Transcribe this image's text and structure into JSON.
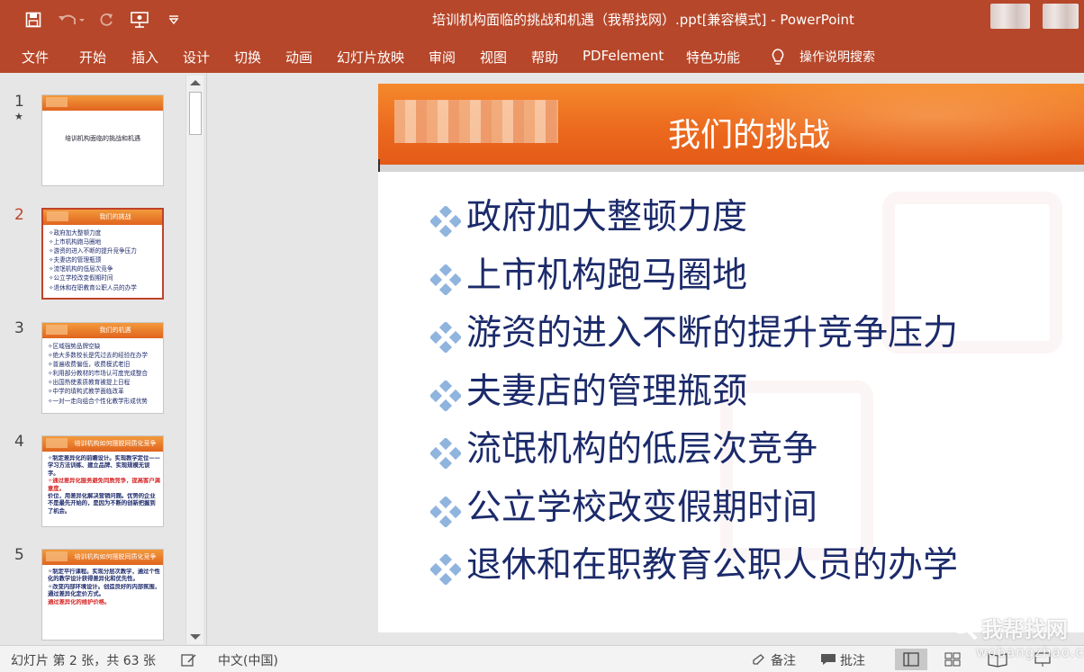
{
  "window": {
    "title": "培训机构面临的挑战和机遇（我帮找网）.ppt[兼容模式]  -  PowerPoint"
  },
  "quick_access": [
    "save-icon",
    "undo-icon",
    "redo-icon",
    "present-from-start-icon",
    "customize-icon"
  ],
  "ribbon": {
    "tabs": [
      "文件",
      "开始",
      "插入",
      "设计",
      "切换",
      "动画",
      "幻灯片放映",
      "审阅",
      "视图",
      "帮助",
      "PDFelement",
      "特色功能"
    ],
    "search_label": "操作说明搜索"
  },
  "thumbnails": [
    {
      "number": "1",
      "has_animation": true,
      "title": "培训机构面临的挑战和机遇",
      "items": []
    },
    {
      "number": "2",
      "active": true,
      "title": "我们的挑战",
      "items": [
        "政府加大整顿力度",
        "上市机构跑马圈地",
        "游资的进入不断的提升竞争压力",
        "夫妻店的管理瓶颈",
        "流氓机构的低层次竞争",
        "公立学校改变假期时间",
        "退休和在职教育公职人员的办学"
      ]
    },
    {
      "number": "3",
      "title": "我们的机遇",
      "items": [
        "区域强势品牌空缺",
        "绝大多数校长是凭过去的经验在办学",
        "普遍收费偏低，收费模式老旧",
        "利用部分教材的市场认可度完成整合",
        "出国热使素质教育被提上日程",
        "中学的填鸭式教学面临改革",
        "一对一走向组合个性化教学形成优势"
      ]
    },
    {
      "number": "4",
      "title": "培训机构如何摆脱同质化竞争",
      "items": [
        {
          "text": "制定差异化的前瞻设计。实现教学定位——学习方法训练、建立品牌、实现规模无误字。",
          "red": false
        },
        {
          "text": "通过差异化服务避免同质竞争，提高客户满意度。",
          "red": true
        },
        {
          "text": "价位，用差异化解决营销问题。优势的企业不是最先开始的，是因为不断的创新把握到了机会。",
          "red": false
        }
      ]
    },
    {
      "number": "5",
      "title": "培训机构如何摆脱同质化竞争",
      "items": [
        {
          "text": "制定平行课程。实现分层次教学，通过个性化的教学设计获得差异化和优先性。",
          "red": false
        },
        {
          "text": "改变内部环境设计。创造良好的内部氛围，通过差异化定价方式。",
          "red": false
        },
        {
          "text": "通过差异化的维护价格。",
          "red": true
        }
      ]
    }
  ],
  "slide": {
    "title": "我们的挑战",
    "bullets": [
      "政府加大整顿力度",
      "上市机构跑马圈地",
      "游资的进入不断的提升竞争压力",
      "夫妻店的管理瓶颈",
      "流氓机构的低层次竞争",
      "公立学校改变假期时间",
      "退休和在职教育公职人员的办学"
    ]
  },
  "status": {
    "slide_info": "幻灯片 第 2 张，共 63 张",
    "language": "中文(中国)",
    "notes_label": "备注",
    "comments_label": "批注"
  },
  "watermark": {
    "line1": "我帮找网",
    "line2": "wobangzhao.com"
  },
  "colors": {
    "ribbon": "#b7472a",
    "slide_band": "#ec6a1e",
    "bullet_text": "#1b2a6a",
    "active_thumb": "#c0432a"
  }
}
